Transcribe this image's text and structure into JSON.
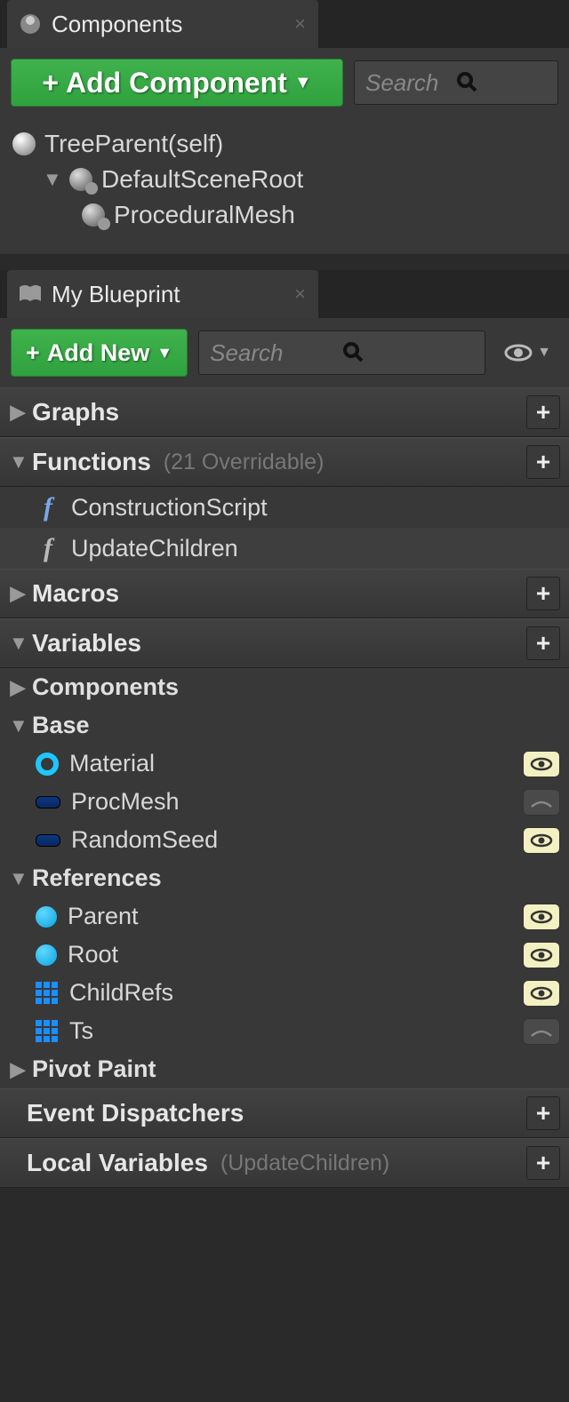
{
  "panels": {
    "components": {
      "tab_title": "Components",
      "add_button": "Add Component",
      "search_placeholder": "Search",
      "tree": {
        "root": "TreeParent(self)",
        "scene_root": "DefaultSceneRoot",
        "child1": "ProceduralMesh"
      }
    },
    "blueprint": {
      "tab_title": "My Blueprint",
      "add_button": "Add New",
      "search_placeholder": "Search",
      "sections": {
        "graphs": {
          "label": "Graphs",
          "expanded": false
        },
        "functions": {
          "label": "Functions",
          "hint": "(21 Overridable)",
          "expanded": true,
          "items": [
            {
              "label": "ConstructionScript",
              "icon": "f-blue"
            },
            {
              "label": "UpdateChildren",
              "icon": "f-grey"
            }
          ]
        },
        "macros": {
          "label": "Macros",
          "expanded": false
        },
        "variables": {
          "label": "Variables",
          "expanded": true,
          "groups": [
            {
              "label": "Components",
              "expanded": false,
              "items": []
            },
            {
              "label": "Base",
              "expanded": true,
              "items": [
                {
                  "label": "Material",
                  "icon": "ring",
                  "visible": true
                },
                {
                  "label": "ProcMesh",
                  "icon": "bluebox",
                  "visible": false
                },
                {
                  "label": "RandomSeed",
                  "icon": "bluebox",
                  "visible": true
                }
              ]
            },
            {
              "label": "References",
              "expanded": true,
              "items": [
                {
                  "label": "Parent",
                  "icon": "cyan",
                  "visible": true
                },
                {
                  "label": "Root",
                  "icon": "cyan",
                  "visible": true
                },
                {
                  "label": "ChildRefs",
                  "icon": "grid",
                  "visible": true
                },
                {
                  "label": "Ts",
                  "icon": "grid",
                  "visible": false
                }
              ]
            },
            {
              "label": "Pivot Paint",
              "expanded": false,
              "items": []
            }
          ]
        },
        "dispatchers": {
          "label": "Event Dispatchers"
        },
        "locals": {
          "label": "Local Variables",
          "hint": "(UpdateChildren)"
        }
      }
    }
  }
}
